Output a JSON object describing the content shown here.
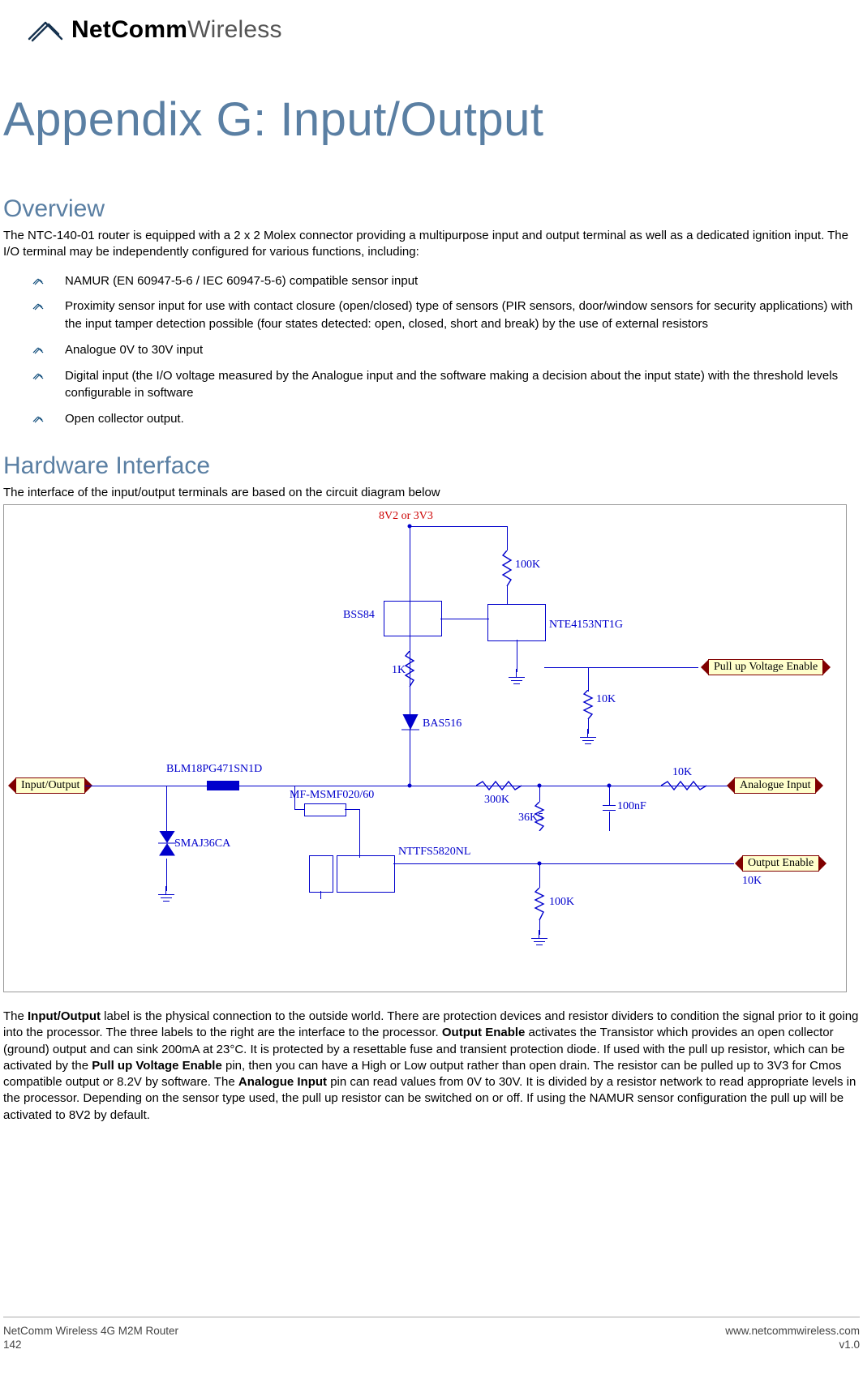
{
  "brand": {
    "name_bold": "NetComm",
    "name_light": "Wireless"
  },
  "title": "Appendix G: Input/Output",
  "overview": {
    "heading": "Overview",
    "intro": "The NTC-140-01 router is equipped with a 2 x 2 Molex connector providing a multipurpose input and output terminal as well as a dedicated ignition input. The I/O terminal may be independently configured for various functions, including:",
    "items": [
      "NAMUR (EN 60947-5-6 / IEC 60947-5-6) compatible sensor input",
      "Proximity sensor input for use with contact closure (open/closed) type of sensors (PIR sensors, door/window sensors for security applications) with the input tamper detection possible (four states detected: open, closed, short and break) by the use of external resistors",
      "Analogue 0V to 30V input",
      "Digital input (the I/O voltage measured by the Analogue input and the software making a decision about the input state) with the threshold levels configurable in software",
      "Open collector output."
    ]
  },
  "hardware": {
    "heading": "Hardware Interface",
    "intro": "The interface of the input/output terminals are based on the circuit diagram below"
  },
  "diagram": {
    "supply": "8V2 or 3V3",
    "parts": {
      "bss84": "BSS84",
      "nte": "NTE4153NT1G",
      "bas516": "BAS516",
      "blm": "BLM18PG471SN1D",
      "mfm": "MF-MSMF020/60",
      "smaj": "SMAJ36CA",
      "nttfs": "NTTFS5820NL"
    },
    "values": {
      "r100k_a": "100K",
      "r100k_b": "100K",
      "r1k": "1K",
      "r10k_a": "10K",
      "r10k_b": "10K",
      "r10k_c": "10K",
      "r300k": "300K",
      "r36k5": "36K5",
      "c100n": "100nF"
    },
    "ports": {
      "io": "Input/Output",
      "pullup_en": "Pull up Voltage Enable",
      "analogue_in": "Analogue Input",
      "output_en": "Output Enable"
    }
  },
  "explain": {
    "t1": "The ",
    "s1": "Input/Output",
    "t2": " label is the physical connection to the outside world. There are protection devices and resistor dividers to condition the signal prior to it going into the processor. The three labels to the right are the interface to the processor. ",
    "s2": "Output Enable",
    "t3": " activates the Transistor which provides an open collector (ground) output and can sink 200mA at 23°C. It is protected by a resettable fuse and transient protection diode. If used with the pull up resistor, which can be activated by the ",
    "s3": "Pull up Voltage Enable",
    "t4": " pin, then you can have a High or Low output rather than open drain. The resistor can be pulled up to 3V3 for Cmos compatible output or 8.2V by software. The ",
    "s4": "Analogue Input",
    "t5": " pin can read values from 0V to 30V. It is divided by a resistor network to read appropriate levels in the processor. Depending on the sensor type used, the pull up resistor can be switched on or off. If using the NAMUR sensor configuration the pull up will be activated to 8V2 by default."
  },
  "footer": {
    "product": "NetComm Wireless 4G M2M Router",
    "page": "142",
    "url": "www.netcommwireless.com",
    "version": "v1.0"
  }
}
